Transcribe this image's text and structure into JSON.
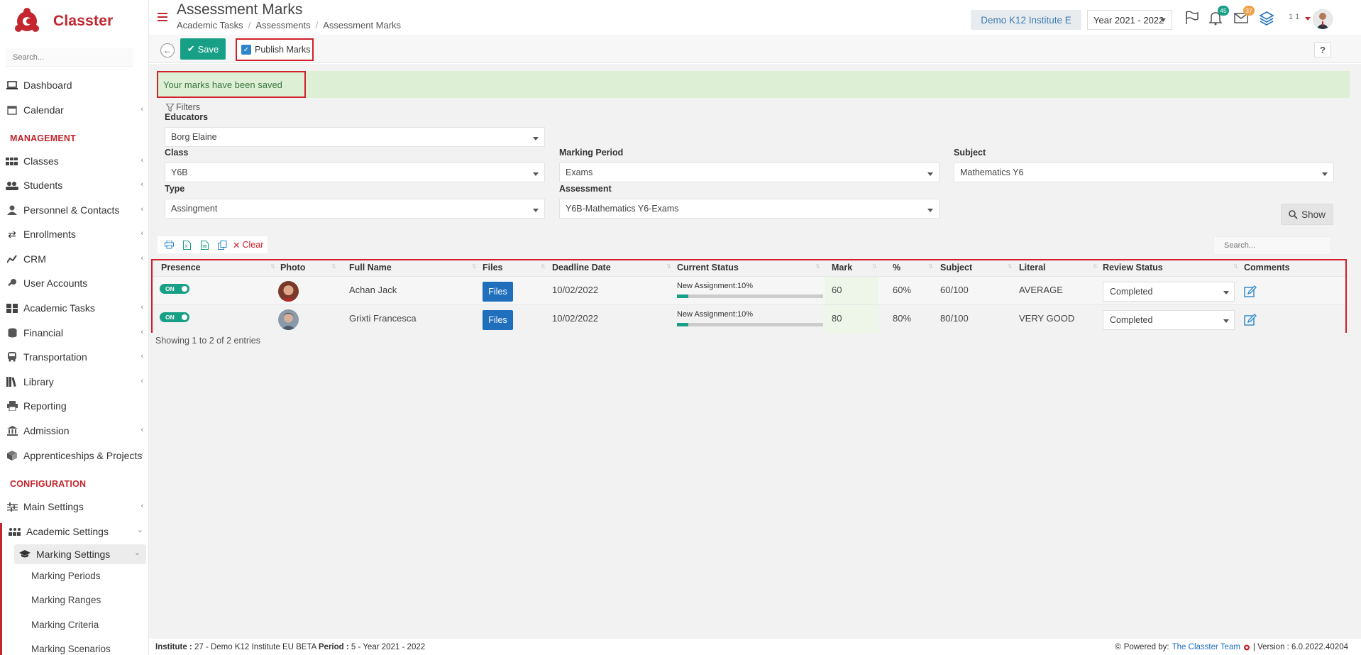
{
  "app": {
    "name": "Classter"
  },
  "sidebar": {
    "search_placeholder": "Search...",
    "items": [
      {
        "label": "Dashboard",
        "icon": "laptop-icon"
      },
      {
        "label": "Calendar",
        "icon": "calendar-icon"
      },
      {
        "label": "Classes",
        "icon": "classes-icon"
      },
      {
        "label": "Students",
        "icon": "students-icon"
      },
      {
        "label": "Personnel & Contacts",
        "icon": "user-icon"
      },
      {
        "label": "Enrollments",
        "icon": "exchange-icon"
      },
      {
        "label": "CRM",
        "icon": "chart-icon"
      },
      {
        "label": "User Accounts",
        "icon": "key-icon"
      },
      {
        "label": "Academic Tasks",
        "icon": "grid-icon"
      },
      {
        "label": "Financial",
        "icon": "coins-icon"
      },
      {
        "label": "Transportation",
        "icon": "bus-icon"
      },
      {
        "label": "Library",
        "icon": "books-icon"
      },
      {
        "label": "Reporting",
        "icon": "printer-icon"
      },
      {
        "label": "Admission",
        "icon": "bank-icon"
      },
      {
        "label": "Apprenticeships & Projects",
        "icon": "cube-icon"
      },
      {
        "label": "Main Settings",
        "icon": "sliders-icon"
      },
      {
        "label": "Academic Settings",
        "icon": "classes-icon"
      },
      {
        "label": "Marking Settings",
        "icon": "graduation-cap-icon"
      }
    ],
    "sections": {
      "management": "MANAGEMENT",
      "configuration": "CONFIGURATION"
    },
    "sub_items": [
      "Marking Periods",
      "Marking Ranges",
      "Marking Criteria",
      "Marking Scenarios"
    ]
  },
  "header": {
    "title": "Assessment Marks",
    "breadcrumb": [
      "Academic Tasks",
      "Assessments",
      "Assessment Marks"
    ],
    "institute": "Demo K12 Institute E",
    "year": "Year 2021 - 2022",
    "notifications_count": "45",
    "messages_count": "37",
    "user_num": "1 1"
  },
  "toolbar": {
    "save_label": "Save",
    "publish_label": "Publish Marks",
    "help_label": "?"
  },
  "alert": {
    "message": "Your marks have been saved"
  },
  "filters": {
    "header": "Filters",
    "educators": {
      "label": "Educators",
      "value": "Borg Elaine"
    },
    "class": {
      "label": "Class",
      "value": "Y6B"
    },
    "marking_period": {
      "label": "Marking Period",
      "value": "Exams"
    },
    "subject": {
      "label": "Subject",
      "value": "Mathematics Y6"
    },
    "type": {
      "label": "Type",
      "value": "Assingment"
    },
    "assessment": {
      "label": "Assessment",
      "value": "Y6B-Mathematics Y6-Exams"
    },
    "show_label": "Show"
  },
  "table": {
    "clear_label": "Clear",
    "search_placeholder": "Search...",
    "columns": [
      "Presence",
      "Photo",
      "Full Name",
      "Files",
      "Deadline Date",
      "Current Status",
      "Mark",
      "%",
      "Subject",
      "Literal",
      "Review Status",
      "Comments"
    ],
    "rows": [
      {
        "presence": "ON",
        "name": "Achan Jack",
        "files": "Files",
        "deadline": "10/02/2022",
        "status": "New Assignment:10%",
        "progress": 0.08,
        "mark": "60",
        "percent": "60%",
        "subject": "60/100",
        "literal": "AVERAGE",
        "review": "Completed"
      },
      {
        "presence": "ON",
        "name": "Grixti Francesca",
        "files": "Files",
        "deadline": "10/02/2022",
        "status": "New Assignment:10%",
        "progress": 0.08,
        "mark": "80",
        "percent": "80%",
        "subject": "80/100",
        "literal": "VERY GOOD",
        "review": "Completed"
      }
    ],
    "showing": "Showing 1 to 2 of 2 entries"
  },
  "footer": {
    "institute_label": "Institute :",
    "institute_value": "27 - Demo K12 Institute EU BETA",
    "period_label": "Period :",
    "period_value": "5 - Year 2021 - 2022",
    "powered_by": "Powered by:",
    "team": "The Classter Team",
    "version": "| Version : 6.0.2022.40204"
  },
  "colors": {
    "brand": "#c3262e",
    "accent": "#17a085",
    "link": "#1f6fbd",
    "alert_bg": "#ddf0d6"
  }
}
